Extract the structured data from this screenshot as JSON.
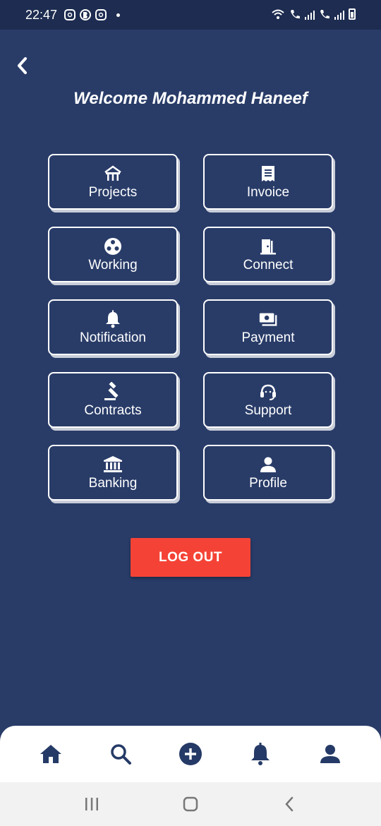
{
  "status_bar": {
    "time": "22:47",
    "icons": [
      "instagram-icon",
      "b-chat-icon",
      "instagram-icon",
      "dot-icon"
    ],
    "right_icons": [
      "wifi-icon",
      "call-signal-1-icon",
      "call-signal-2-icon",
      "battery-charging-icon"
    ]
  },
  "header": {
    "back_icon": "chevron-left-icon",
    "title": "Welcome Mohammed Haneef"
  },
  "menu": [
    {
      "label": "Projects",
      "icon": "building-icon"
    },
    {
      "label": "Invoice",
      "icon": "receipt-icon"
    },
    {
      "label": "Working",
      "icon": "film-reel-icon"
    },
    {
      "label": "Connect",
      "icon": "door-icon"
    },
    {
      "label": "Notification",
      "icon": "bell-icon"
    },
    {
      "label": "Payment",
      "icon": "money-icon"
    },
    {
      "label": "Contracts",
      "icon": "gavel-icon"
    },
    {
      "label": "Support",
      "icon": "headset-icon"
    },
    {
      "label": "Banking",
      "icon": "bank-icon"
    },
    {
      "label": "Profile",
      "icon": "user-icon"
    }
  ],
  "logout": {
    "label": "LOG OUT"
  },
  "bottom_nav": [
    "home-icon",
    "search-icon",
    "add-circle-icon",
    "bell-icon",
    "user-icon"
  ],
  "colors": {
    "background": "#293c68",
    "status_bar": "#1d2c50",
    "logout": "#f44336",
    "nav_icon": "#253a66"
  }
}
